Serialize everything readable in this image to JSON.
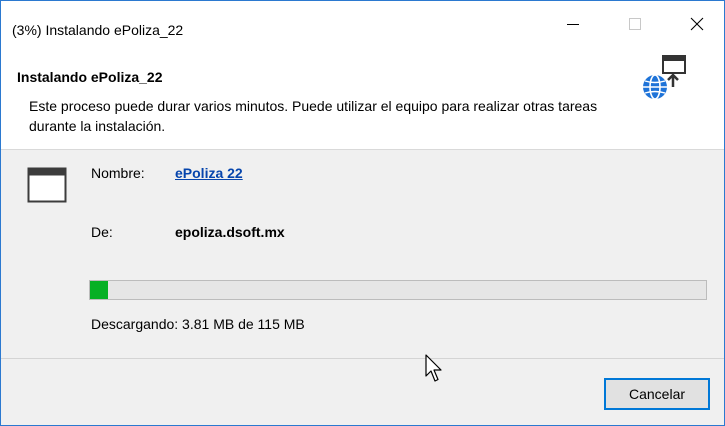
{
  "window": {
    "title": "(3%) Instalando ePoliza_22",
    "accent_color": "#2b79d0",
    "controls": {
      "minimize_icon": "minimize-icon",
      "maximize_icon": "maximize-icon",
      "close_icon": "close-icon"
    }
  },
  "header": {
    "title": "Instalando ePoliza_22",
    "description": "Este proceso puede durar varios minutos. Puede utilizar el equipo para realizar otras tareas durante la instalación.",
    "icon": "globe-install-icon"
  },
  "details": {
    "app_icon": "application-window-icon",
    "name_label": "Nombre:",
    "name_value": "ePoliza 22",
    "from_label": "De:",
    "from_value": "epoliza.dsoft.mx"
  },
  "progress": {
    "value_percent": 3,
    "fill_color": "#06b025",
    "status_text": "Descargando: 3.81 MB de 115 MB"
  },
  "footer": {
    "cancel_label": "Cancelar"
  }
}
